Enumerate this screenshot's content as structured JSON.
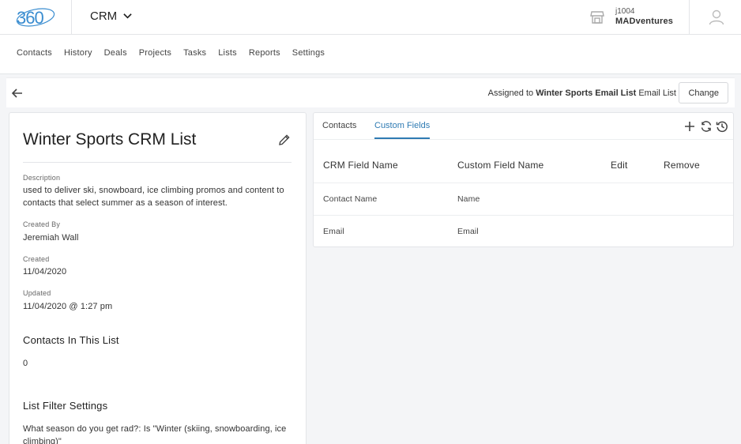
{
  "app": {
    "logo_text": "360",
    "name": "CRM"
  },
  "account": {
    "id": "j1004",
    "name": "MADventures"
  },
  "nav": {
    "items": [
      "Contacts",
      "History",
      "Deals",
      "Projects",
      "Tasks",
      "Lists",
      "Reports",
      "Settings"
    ]
  },
  "actionbar": {
    "assigned_prefix": "Assigned to",
    "assigned_list": "Winter Sports Email List",
    "assigned_suffix": "Email List",
    "change_label": "Change"
  },
  "list": {
    "title": "Winter Sports CRM List",
    "description_label": "Description",
    "description": "used to deliver ski, snowboard, ice climbing promos and content to contacts that select summer as a season of interest.",
    "created_by_label": "Created By",
    "created_by": "Jeremiah Wall",
    "created_label": "Created",
    "created": "11/04/2020",
    "updated_label": "Updated",
    "updated": "11/04/2020 @ 1:27 pm",
    "contacts_title": "Contacts In This List",
    "contacts_count": "0",
    "filter_title": "List Filter Settings",
    "filter_text": "What season do you get rad?: Is \"Winter (skiing, snowboarding, ice climbing)\""
  },
  "panel": {
    "tabs": [
      "Contacts",
      "Custom Fields"
    ],
    "active_tab": "Custom Fields",
    "icons": [
      "plus-icon",
      "sync-icon",
      "history-icon"
    ],
    "columns": [
      "CRM Field Name",
      "Custom Field Name",
      "Edit",
      "Remove"
    ],
    "rows": [
      {
        "crm": "Contact Name",
        "custom": "Name"
      },
      {
        "crm": "Email",
        "custom": "Email"
      }
    ]
  },
  "colors": {
    "accent": "#2f7bb3",
    "logo_blue": "#3a8dd0"
  }
}
